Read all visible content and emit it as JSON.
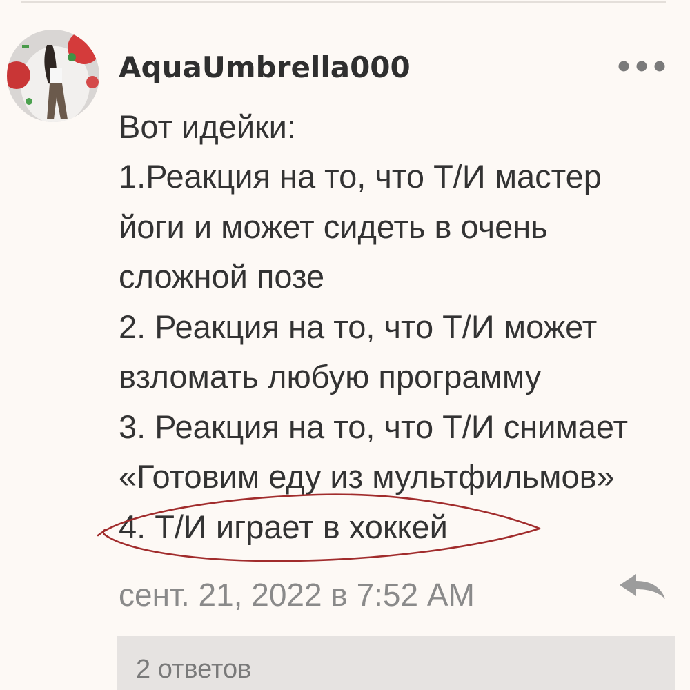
{
  "comment": {
    "author": "AquaUmbrella000",
    "lines": [
      "Вот идейки:",
      "1.Реакция на то, что Т/И мастер",
      "йоги и может сидеть в очень",
      "сложной позе",
      "2. Реакция на то, что Т/И может",
      "взломать любую программу",
      "3. Реакция на то, что Т/И снимает",
      "«Готовим еду из мультфильмов»",
      "4. Т/И играет в хоккей"
    ],
    "timestamp": "сент. 21, 2022 в 7:52 AM",
    "replies_label": "2 ответов"
  },
  "icons": {
    "avatar": "user-avatar-image",
    "more": "more-dots-icon",
    "reply": "reply-arrow-icon",
    "annotation": "hand-drawn-ellipse"
  },
  "colors": {
    "background": "#fdf9f5",
    "text": "#333333",
    "muted": "#8a8a8a",
    "annotation": "#a12c2c",
    "replies_background": "#e6e3e1"
  }
}
